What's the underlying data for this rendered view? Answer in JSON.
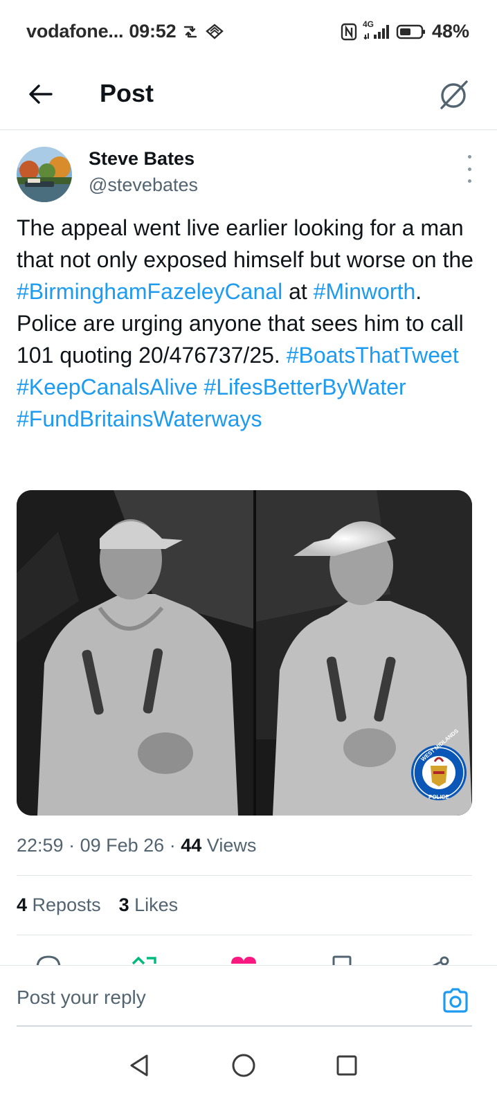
{
  "status_bar": {
    "carrier": "vodafone...",
    "time": "09:52",
    "network": "4G",
    "battery": "48%"
  },
  "header": {
    "title": "Post"
  },
  "post": {
    "author_name": "Steve Bates",
    "author_handle": "@stevebates",
    "text_parts": {
      "p1": "The appeal went live earlier looking for a man that not only exposed himself but worse on the ",
      "tag1": "#BirminghamFazeleyCanal",
      "p2": " at ",
      "tag2": "#Minworth",
      "p3": ". Police are urging anyone that sees him to call 101 quoting 20/476737/25. ",
      "tag3": "#BoatsThatTweet",
      "tag4": "#KeepCanalsAlive",
      "tag5": "#LifesBetterByWater",
      "tag6": "#FundBritainsWaterways"
    },
    "logo_text": "WEST MIDLANDS POLICE",
    "time": "22:59",
    "date": "09 Feb 26",
    "separator": "·",
    "views_count": "44",
    "views_label": "Views",
    "reposts_count": "4",
    "reposts_label": "Reposts",
    "likes_count": "3",
    "likes_label": "Likes"
  },
  "reply": {
    "placeholder": "Post your reply"
  },
  "colors": {
    "link": "#1d9bf0",
    "text": "#0f1419",
    "secondary": "#536471",
    "like": "#f91880",
    "repost": "#00ba7c"
  },
  "icons": {
    "back": "arrow-left-icon",
    "grok": "grok-icon",
    "more": "more-vertical-icon",
    "camera": "camera-icon",
    "reply": "reply-icon",
    "repost": "repost-icon",
    "like": "heart-icon",
    "bookmark": "bookmark-icon",
    "share": "share-icon"
  }
}
